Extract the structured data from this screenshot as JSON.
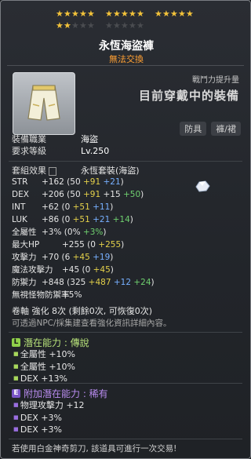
{
  "star_force": {
    "filled": 17,
    "total": 25
  },
  "item": {
    "name": "永恆海盜褲",
    "tradable_text": "無法交換",
    "power_label": "戰鬥力提升量",
    "current_equip_text": "目前穿戴中的裝備",
    "tags": [
      "防具",
      "褲/裙"
    ],
    "icon": "pants-icon"
  },
  "info": [
    {
      "key": "裝備職業",
      "val": "海盜"
    },
    {
      "key": "要求等級",
      "val": "Lv.250"
    }
  ],
  "set_effect": {
    "label": "套組效果",
    "value": "永恆套裝(海盜)"
  },
  "stats": [
    {
      "name": "STR",
      "text": "+162 (50 ",
      "parts": [
        [
          "gold",
          "+91"
        ],
        [
          "blue",
          " +21"
        ]
      ],
      "end": ")"
    },
    {
      "name": "DEX",
      "text": "+206 (50 ",
      "parts": [
        [
          "gold",
          "+91"
        ],
        [
          "white",
          " +15"
        ],
        [
          "green",
          " +50"
        ]
      ],
      "end": ")"
    },
    {
      "name": "INT",
      "text": "+62 (0 ",
      "parts": [
        [
          "gold",
          "+51"
        ],
        [
          "blue",
          " +11"
        ]
      ],
      "end": ")"
    },
    {
      "name": "LUK",
      "text": "+86 (0 ",
      "parts": [
        [
          "gold",
          "+51"
        ],
        [
          "blue",
          " +21"
        ],
        [
          "green",
          " +14"
        ]
      ],
      "end": ")"
    },
    {
      "name": "全屬性",
      "text": "+3% (0% ",
      "parts": [
        [
          "green",
          "+3%"
        ]
      ],
      "end": ")"
    },
    {
      "name": "最大HP",
      "text": "+255 (0 ",
      "parts": [
        [
          "gold",
          "+255"
        ]
      ],
      "end": ")"
    },
    {
      "name": "攻擊力",
      "text": "+70 (6 ",
      "parts": [
        [
          "gold",
          "+45"
        ],
        [
          "blue",
          " +19"
        ]
      ],
      "end": ")"
    },
    {
      "name": "魔法攻擊力",
      "text": "+45 (0 ",
      "parts": [
        [
          "gold",
          "+45"
        ]
      ],
      "end": ")"
    },
    {
      "name": "防禦力",
      "text": "+848 (325 ",
      "parts": [
        [
          "gold",
          "+487"
        ],
        [
          "blue",
          " +12"
        ],
        [
          "green",
          " +24"
        ]
      ],
      "end": ")"
    },
    {
      "name": "無視怪物防禦率",
      "text": "+5%",
      "parts": [],
      "end": ""
    }
  ],
  "enhance": {
    "line": "卷軸 強化 8次 (剩餘0次, 可恢復0次)",
    "hint": "可透過NPC/採集建查看強化資訊詳細內容。"
  },
  "potential": {
    "label": "潛在能力 : 傳說",
    "lines": [
      "全屬性 +10%",
      "全屬性 +10%",
      "DEX +13%"
    ]
  },
  "bonus_potential": {
    "label": "附加潛在能力 : 稀有",
    "lines": [
      "物理攻擊力 +12",
      "DEX +3%",
      "DEX +3%"
    ]
  },
  "footer": "若使用白金神奇剪刀, 該道具可進行一次交易!",
  "colors": {
    "gold": "#e4d14a",
    "blue": "#77b0ff",
    "green": "#6fd06f",
    "legendary": "#8fd04a",
    "rare": "#7a55c8"
  }
}
